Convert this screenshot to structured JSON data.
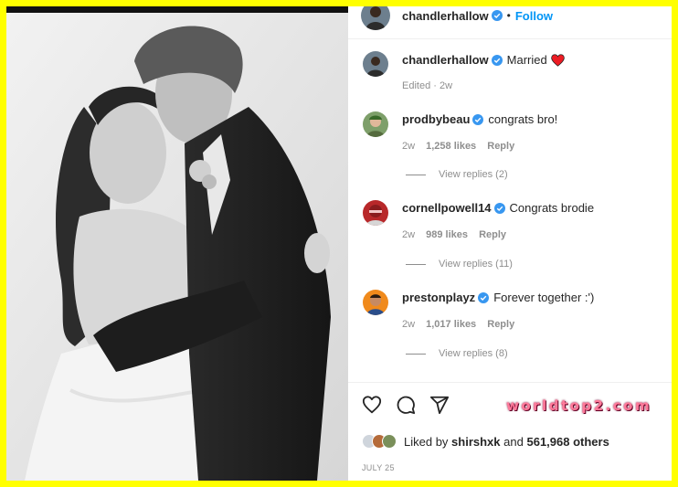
{
  "header": {
    "username": "chandlerhallow",
    "follow_label": "Follow",
    "separator": "•"
  },
  "caption": {
    "username": "chandlerhallow",
    "text": "Married",
    "meta": "Edited · 2w"
  },
  "comments": [
    {
      "username": "prodbybeau",
      "text": "congrats bro!",
      "age": "2w",
      "likes": "1,258 likes",
      "reply_label": "Reply",
      "view_replies": "View replies (2)"
    },
    {
      "username": "cornellpowell14",
      "text": "Congrats brodie",
      "age": "2w",
      "likes": "989 likes",
      "reply_label": "Reply",
      "view_replies": "View replies (11)"
    },
    {
      "username": "prestonplayz",
      "text": "Forever together :')",
      "age": "2w",
      "likes": "1,017 likes",
      "reply_label": "Reply",
      "view_replies": "View replies (8)"
    }
  ],
  "likes": {
    "prefix": "Liked by",
    "user": "shirshxk",
    "middle": "and",
    "count": "561,968 others"
  },
  "date": "JULY 25",
  "watermark": "worldtop2.com",
  "icons": [
    "heart-icon",
    "comment-icon",
    "share-icon",
    "verified-icon"
  ],
  "colors": {
    "border": "#ffff00",
    "accent": "#0095f6",
    "verified": "#3897f0",
    "heart": "#ed4956"
  }
}
